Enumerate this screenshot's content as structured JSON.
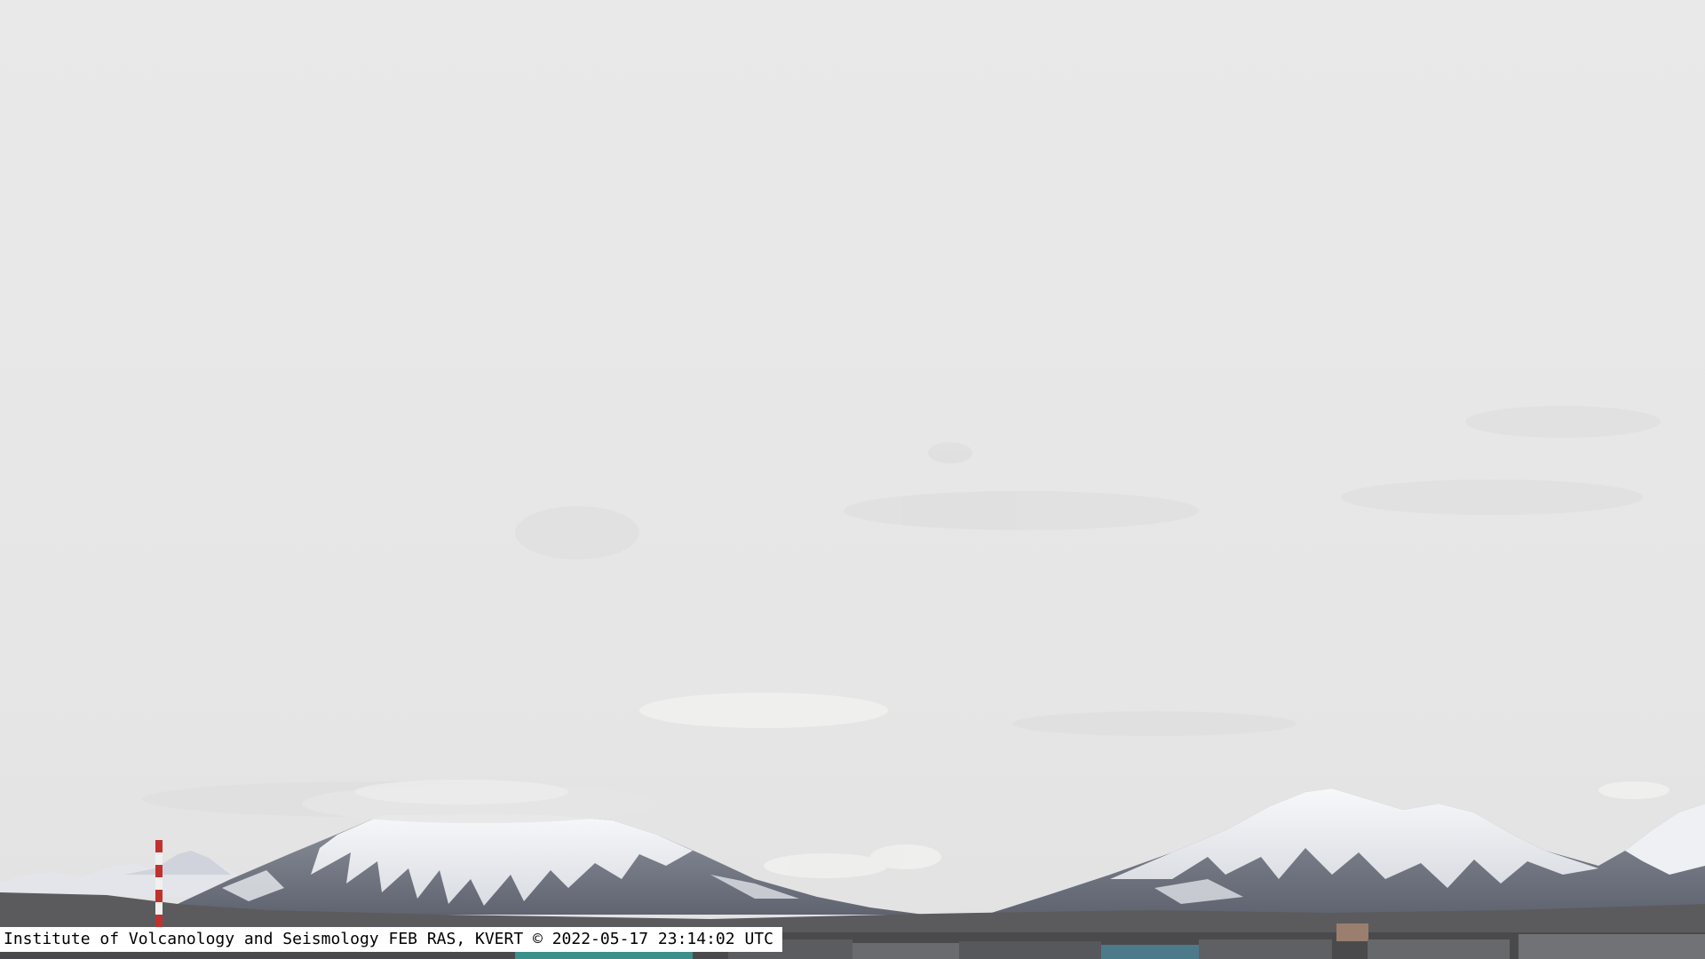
{
  "webcam": {
    "caption": "Institute of Volcanology and Seismology FEB RAS, KVERT © 2022-05-17 23:14:02 UTC"
  },
  "scene": {
    "sky_color": "#e9e9e9",
    "snow_color": "#f2f3f5",
    "rock_color": "#6e7380",
    "ground_color": "#4a4a4c",
    "chimney_red": "#c0322e"
  }
}
